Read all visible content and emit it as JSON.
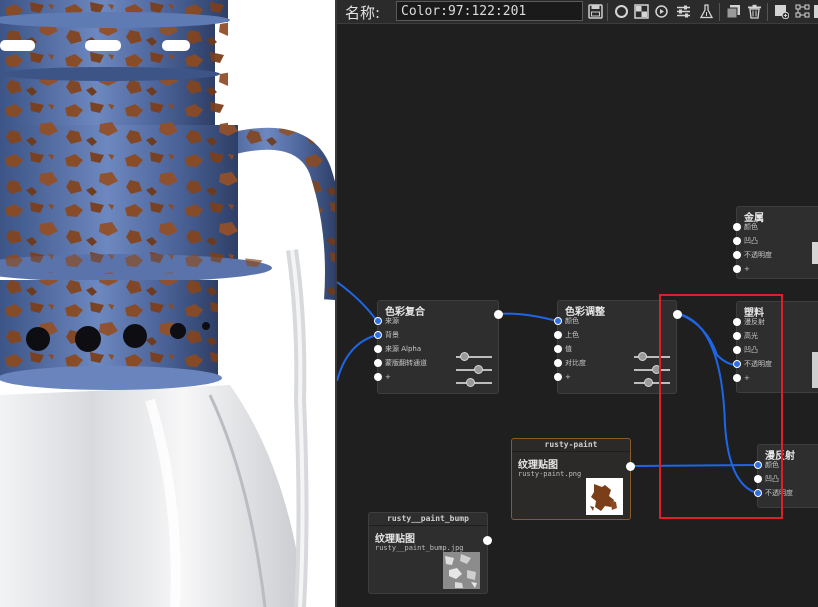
{
  "toolbar": {
    "name_label": "名称:",
    "name_value": "Color:97:122:201",
    "icons": [
      "save-icon",
      "sphere-preview-icon",
      "checker-preview-icon",
      "refresh-icon",
      "sliders-icon",
      "flask-icon",
      "copy-icon",
      "trash-icon",
      "material-add-icon",
      "node-graph-icon"
    ]
  },
  "colors": {
    "editor_bg": "#1f1f1f",
    "node_bg": "#2e2e2e",
    "wire": "#1e66e6",
    "selection": "#e01e2a",
    "paint_blue": "#4f6ea8",
    "rust": "#8a4a22"
  },
  "nodes": {
    "metal": {
      "title": "金属",
      "ports": [
        "颜色",
        "凹凸",
        "不透明度",
        "+"
      ]
    },
    "color_composite": {
      "title": "色彩复合",
      "ports": [
        "来源",
        "背景",
        "来源 Alpha",
        "蒙版翻转通道",
        "+"
      ]
    },
    "color_adjust": {
      "title": "色彩调整",
      "ports": [
        "颜色",
        "上色",
        "值",
        "对比度",
        "+"
      ]
    },
    "plastic": {
      "title": "塑料",
      "ports": [
        "漫反射",
        "高光",
        "凹凸",
        "不透明度",
        "+"
      ]
    },
    "diffuse": {
      "title": "漫反射",
      "ports": [
        "颜色",
        "凹凸",
        "不透明度"
      ]
    },
    "rusty_paint": {
      "header": "rusty-paint",
      "title": "纹理贴图",
      "file": "rusty-paint.png"
    },
    "rusty_paint_bump": {
      "header": "rusty__paint_bump",
      "title": "纹理贴图",
      "file": "rusty__paint_bump.jpg"
    }
  }
}
